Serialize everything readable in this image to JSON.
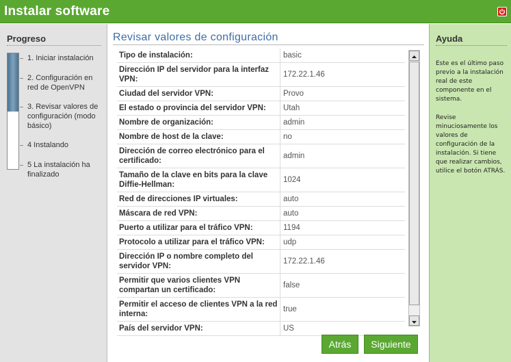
{
  "window": {
    "title": "Instalar software"
  },
  "sidebar": {
    "title": "Progreso",
    "progress_fraction": 0.5,
    "steps": [
      {
        "label": "1. Iniciar instalación"
      },
      {
        "label": "2. Configuración en red de OpenVPN"
      },
      {
        "label": "3. Revisar valores de configuración (modo básico)"
      },
      {
        "label": "4 Instalando"
      },
      {
        "label": "5 La instalación ha finalizado"
      }
    ]
  },
  "main": {
    "title": "Revisar valores de configuración",
    "rows": [
      {
        "label": "Tipo de instalación:",
        "value": "basic"
      },
      {
        "label": "Dirección IP del servidor para la interfaz VPN:",
        "value": "172.22.1.46"
      },
      {
        "label": "Ciudad del servidor VPN:",
        "value": "Provo"
      },
      {
        "label": "El estado o provincia del servidor VPN:",
        "value": "Utah"
      },
      {
        "label": "Nombre de organización:",
        "value": "admin"
      },
      {
        "label": "Nombre de host de la clave:",
        "value": "no"
      },
      {
        "label": "Dirección de correo electrónico para el certificado:",
        "value": "admin"
      },
      {
        "label": "Tamaño de la clave en bits para la clave Diffie-Hellman:",
        "value": "1024"
      },
      {
        "label": "Red de direcciones IP virtuales:",
        "value": "auto"
      },
      {
        "label": "Máscara de red VPN:",
        "value": "auto"
      },
      {
        "label": "Puerto a utilizar para el tráfico VPN:",
        "value": "1194"
      },
      {
        "label": "Protocolo a utilizar para el tráfico VPN:",
        "value": "udp"
      },
      {
        "label": "Dirección IP o nombre completo del servidor VPN:",
        "value": "172.22.1.46"
      },
      {
        "label": "Permitir que varios clientes VPN compartan un certificado:",
        "value": "false"
      },
      {
        "label": "Permitir el acceso de clientes VPN a la red interna:",
        "value": "true"
      },
      {
        "label": "País del servidor VPN:",
        "value": "US"
      }
    ],
    "back_label": "Atrás",
    "next_label": "Siguiente"
  },
  "help": {
    "title": "Ayuda",
    "paragraph1": "Este es el último paso previo a la instalación real de este componente en el sistema.",
    "paragraph2": "Revise minuciosamente los valores de configuración de la instalación. Si tiene que realizar cambios, utilice el botón ATRÁS."
  },
  "colors": {
    "accent": "#5aa832",
    "heading_blue": "#3e6ea6",
    "help_bg": "#c9e6b0",
    "close": "#d9211b"
  },
  "icons": {
    "close": "power-close-icon"
  }
}
